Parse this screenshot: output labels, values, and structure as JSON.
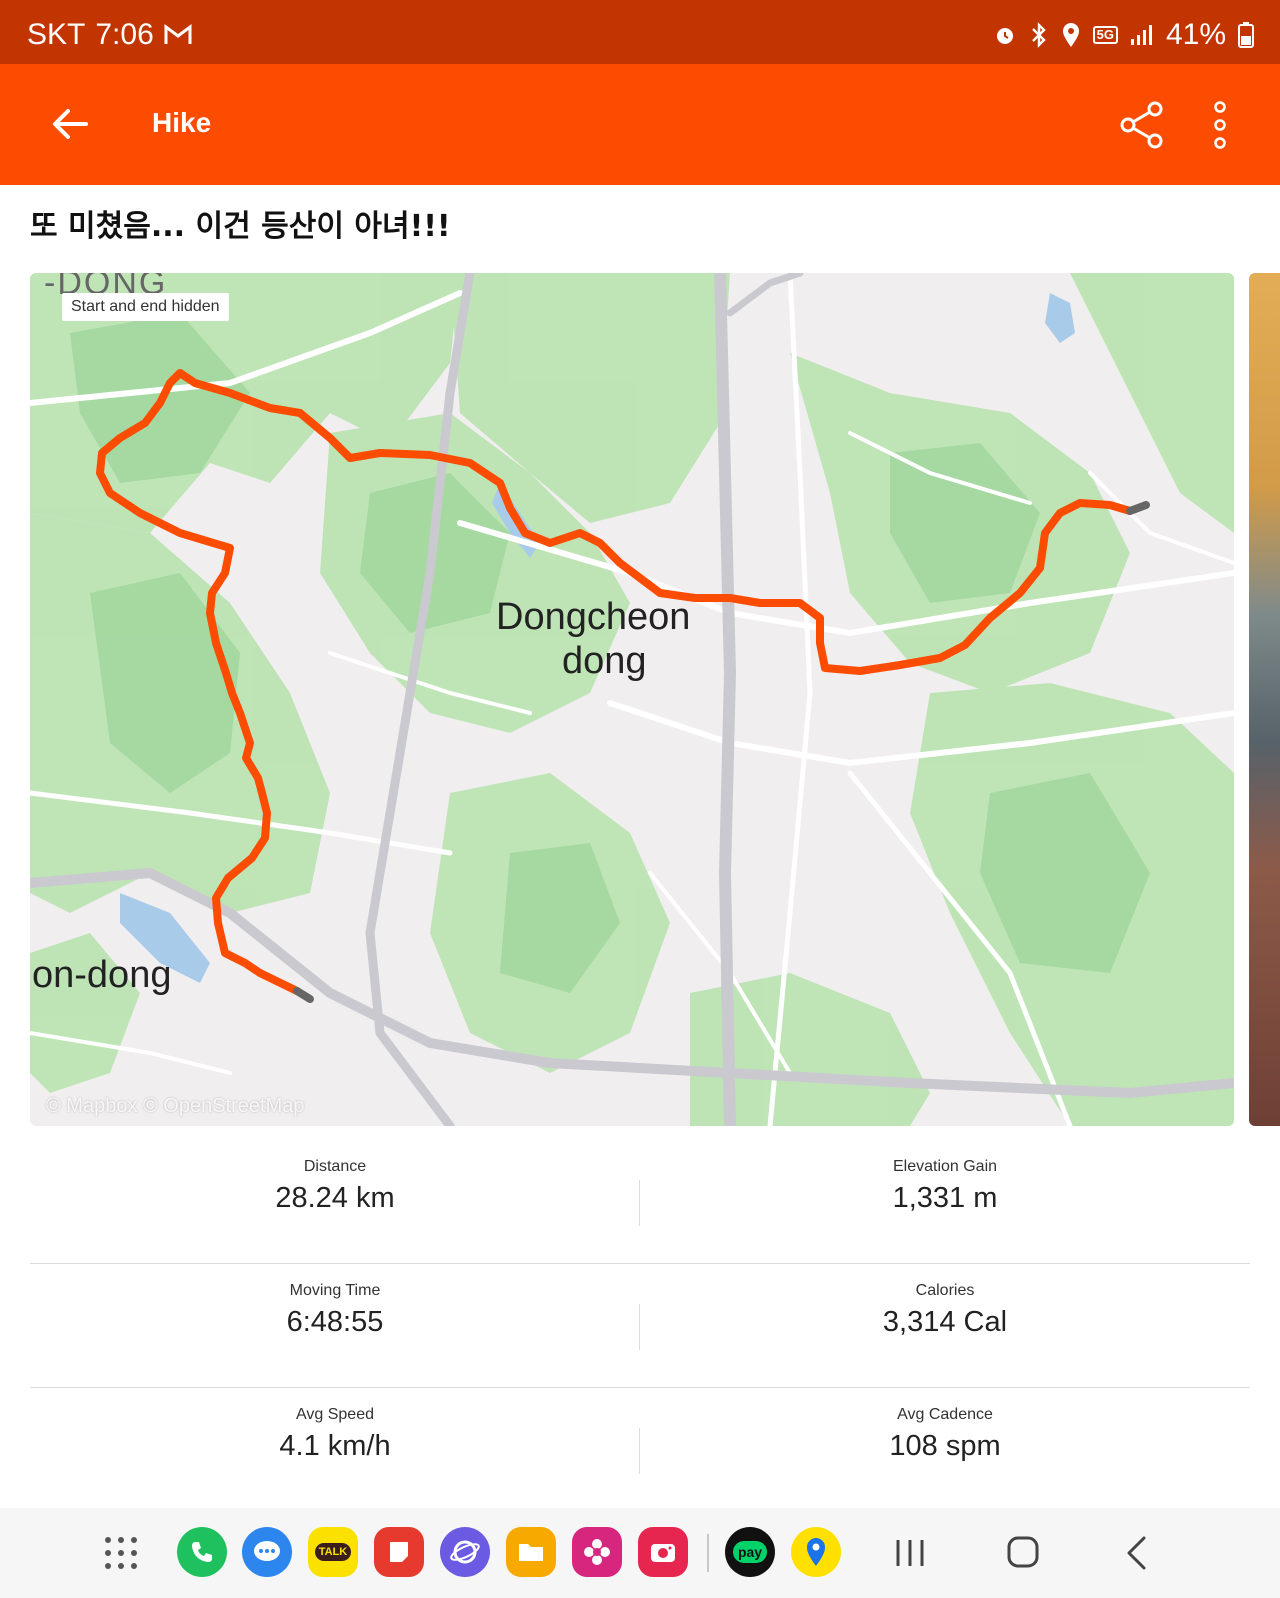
{
  "status_bar": {
    "carrier": "SKT",
    "time": "7:06",
    "network": "5G",
    "battery": "41%"
  },
  "app_bar": {
    "title": "Hike"
  },
  "activity": {
    "title": "또 미쳤음... 이건 등산이 아녀!!!"
  },
  "map": {
    "privacy_badge": "Start and end hidden",
    "labels": {
      "top_left": "-DONG",
      "center_line1": "Dongcheon",
      "center_line2": "dong",
      "bottom_left": "on-dong"
    },
    "attribution": "© Mapbox © OpenStreetMap",
    "route_color": "#fc4c02"
  },
  "stats": [
    {
      "label": "Distance",
      "value": "28.24 km"
    },
    {
      "label": "Elevation Gain",
      "value": "1,331 m"
    },
    {
      "label": "Moving Time",
      "value": "6:48:55"
    },
    {
      "label": "Calories",
      "value": "3,314 Cal"
    },
    {
      "label": "Avg Speed",
      "value": "4.1 km/h"
    },
    {
      "label": "Avg Cadence",
      "value": "108 spm"
    }
  ],
  "dock": [
    {
      "name": "apps-grid-icon",
      "color": "#555555"
    },
    {
      "name": "phone-app-icon",
      "color": "#1fc15f"
    },
    {
      "name": "messages-app-icon",
      "color": "#2c86ee"
    },
    {
      "name": "kakaotalk-app-icon",
      "color": "#fae100",
      "label": "TALK"
    },
    {
      "name": "notes-app-icon",
      "color": "#e63a2e"
    },
    {
      "name": "internet-app-icon",
      "color": "#6a5be2"
    },
    {
      "name": "files-app-icon",
      "color": "#f7a900"
    },
    {
      "name": "gallery-app-icon",
      "color": "#d7267d"
    },
    {
      "name": "camera-app-icon",
      "color": "#e6264f"
    },
    {
      "name": "pay-app-icon",
      "color": "#111111",
      "label": "pay"
    },
    {
      "name": "maps-app-icon",
      "color": "#ffe000"
    }
  ]
}
